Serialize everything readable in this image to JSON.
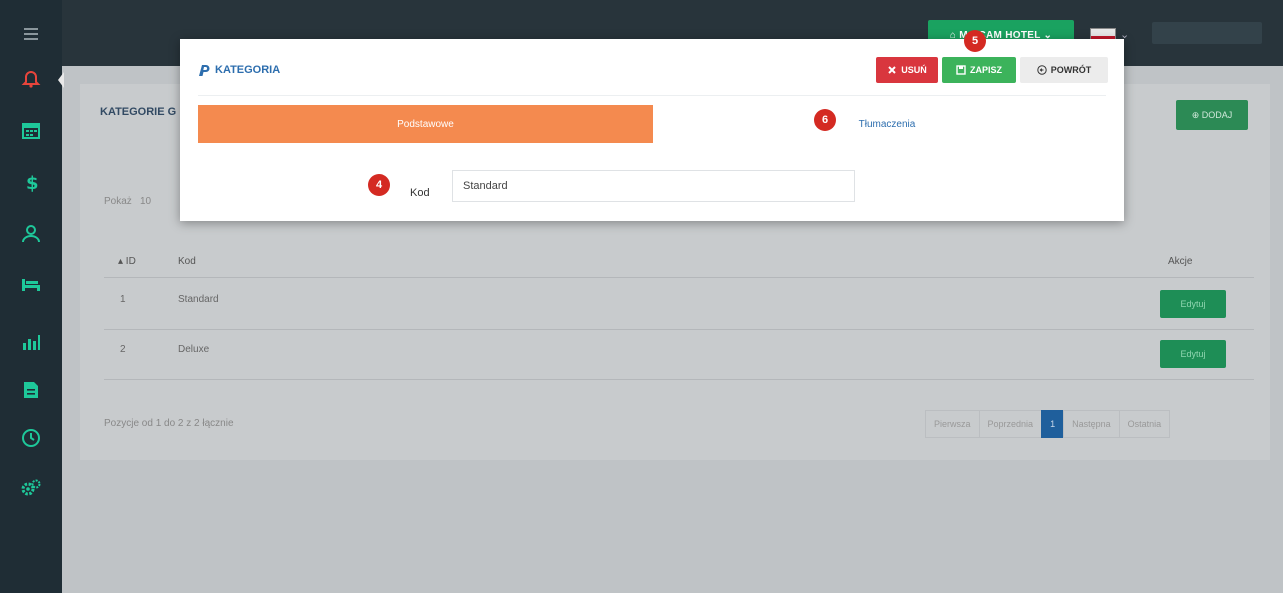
{
  "topbar": {
    "hotel_button": "⌂ M  CAM HOTEL ⌄",
    "flag_caret": "⌄"
  },
  "panel": {
    "title": "KATEGORIE G",
    "add_button": "⊕ DODAJ",
    "show_label": "Pokaż",
    "show_value": "10",
    "columns": {
      "id": "▴ ID",
      "kod": "Kod",
      "actions": "Akcje"
    },
    "rows": [
      {
        "id": "1",
        "kod": "Standard",
        "action": "Edytuj"
      },
      {
        "id": "2",
        "kod": "Deluxe",
        "action": "Edytuj"
      }
    ],
    "position_info": "Pozycje od 1 do 2 z 2 łącznie",
    "pagination": {
      "first": "Pierwsza",
      "prev": "Poprzednia",
      "current": "1",
      "next": "Następna",
      "last": "Ostatnia"
    }
  },
  "modal": {
    "title": "KATEGORIA",
    "delete_button": "USUŃ",
    "save_button": "ZAPISZ",
    "back_button": "POWRÓT",
    "tab_basic": "Podstawowe",
    "tab_translations": "Tłumaczenia",
    "kod_label": "Kod",
    "kod_value": "Standard"
  },
  "badges": {
    "kod": "4",
    "save": "5",
    "translations": "6"
  },
  "colors": {
    "sidebar_bg": "#1f2d35",
    "sidebar_icon": "#1ec89a",
    "sidebar_active_icon": "#e8453c",
    "orange_tab": "#f48a4f",
    "save_green": "#3cb35b",
    "delete_red": "#d9363e",
    "badge_red": "#d42a22"
  },
  "sidebar": {
    "items": [
      "menu-icon",
      "bell-icon",
      "calendar-icon",
      "dollar-icon",
      "users-icon",
      "bed-icon",
      "chart-icon",
      "document-icon",
      "clock-icon",
      "settings-icon"
    ]
  }
}
